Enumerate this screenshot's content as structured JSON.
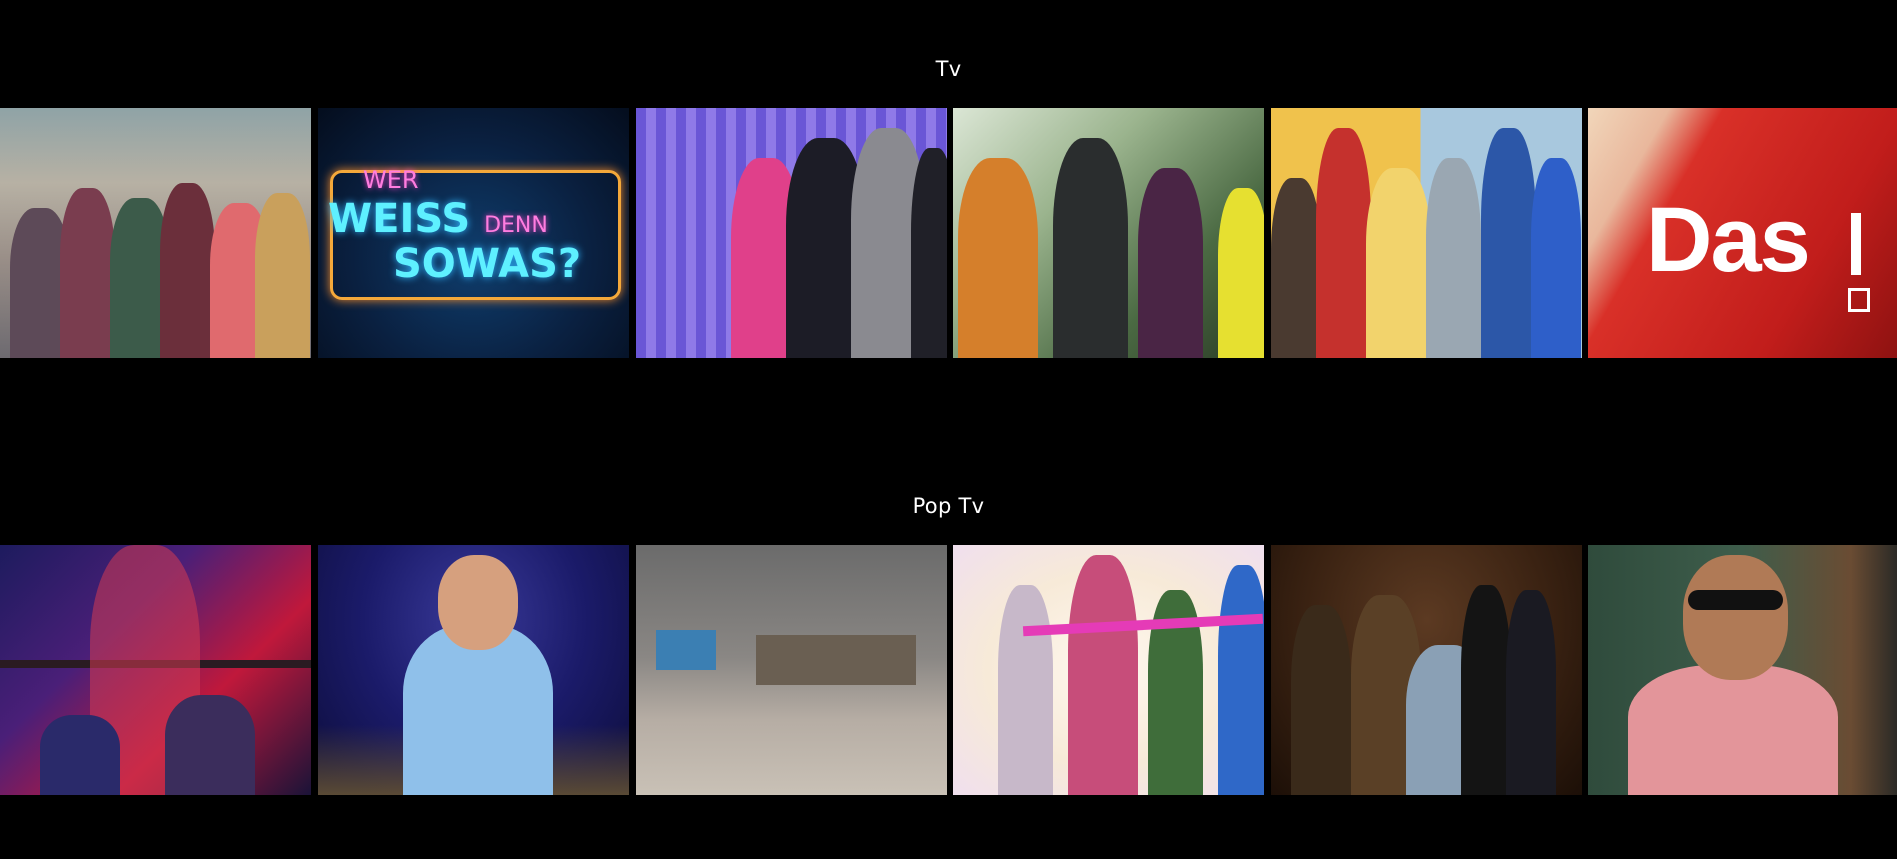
{
  "rows": [
    {
      "title": "Tv",
      "cards": [
        {
          "name": "tv-card-1",
          "art": "ensemble-cast-street"
        },
        {
          "name": "tv-card-2",
          "art": "wer-weiss-denn-sowas-logo",
          "logo": {
            "line1": "WER",
            "line2": "WEISS",
            "line2b": "DENN",
            "line3": "SOWAS?"
          }
        },
        {
          "name": "tv-card-3",
          "art": "game-show-hosts-money"
        },
        {
          "name": "tv-card-4",
          "art": "forest-cast"
        },
        {
          "name": "tv-card-5",
          "art": "korean-drama-cast"
        },
        {
          "name": "tv-card-6",
          "art": "das-logo",
          "logo": {
            "text": "Das"
          }
        }
      ]
    },
    {
      "title": "Pop Tv",
      "cards": [
        {
          "name": "poptv-card-1",
          "art": "animated-warriors"
        },
        {
          "name": "poptv-card-2",
          "art": "smiling-host-night"
        },
        {
          "name": "poptv-card-3",
          "art": "courtyard-shelters"
        },
        {
          "name": "poptv-card-4",
          "art": "roller-skate-girls"
        },
        {
          "name": "poptv-card-5",
          "art": "ranch-family-drama"
        },
        {
          "name": "poptv-card-6",
          "art": "laughing-man-sunglasses"
        }
      ]
    }
  ]
}
